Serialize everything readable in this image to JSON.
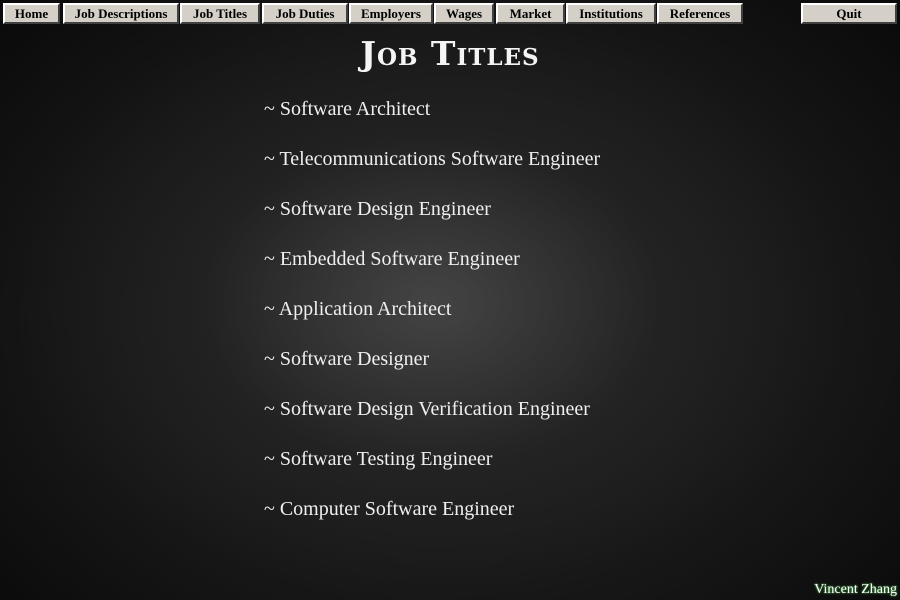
{
  "nav": {
    "home": "Home",
    "job_descriptions": "Job Descriptions",
    "job_titles": "Job Titles",
    "job_duties": "Job Duties",
    "employers": "Employers",
    "wages": "Wages",
    "market": "Market",
    "institutions": "Institutions",
    "references": "References",
    "quit": "Quit"
  },
  "page_title": "Job Titles",
  "job_titles": [
    "~ Software Architect",
    "~ Telecommunications Software Engineer",
    "~ Software Design Engineer",
    "~ Embedded Software Engineer",
    "~ Application Architect",
    "~ Software Designer",
    "~ Software Design Verification Engineer",
    "~ Software Testing Engineer",
    "~ Computer Software Engineer"
  ],
  "author": "Vincent Zhang"
}
